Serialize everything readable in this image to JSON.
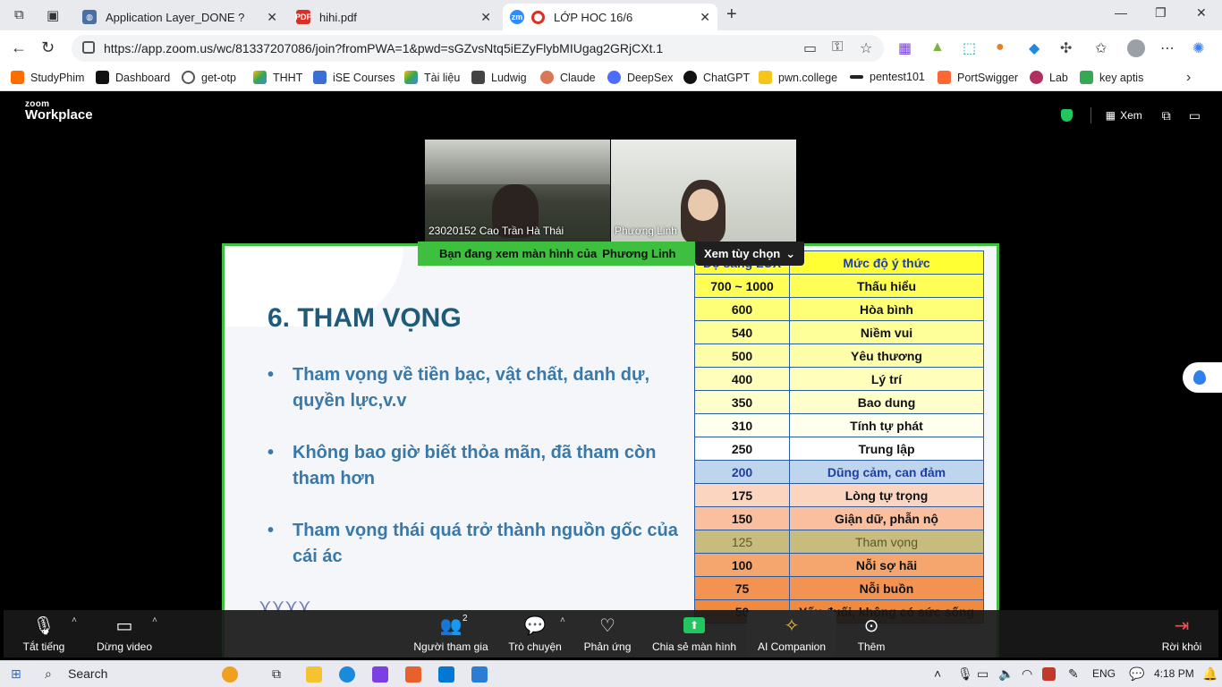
{
  "browser": {
    "tabs": [
      {
        "title": "Application Layer_DONE ?",
        "active": false
      },
      {
        "title": "hihi.pdf",
        "active": false
      },
      {
        "title": "LỚP HOC 16/6",
        "active": true
      }
    ],
    "url": "https://app.zoom.us/wc/81337207086/join?fromPWA=1&pwd=sGZvsNtq5iEZyFlybMIUgag2GRjCXt.1",
    "bookmarks": [
      "StudyPhim",
      "Dashboard",
      "get-otp",
      "THHT",
      "iSE Courses",
      "Tài liệu",
      "Ludwig",
      "Claude",
      "DeepSex",
      "ChatGPT",
      "pwn.college",
      "pentest101",
      "PortSwigger",
      "Lab",
      "key aptis"
    ]
  },
  "zoom": {
    "logo_top": "zoom",
    "logo_bottom": "Workplace",
    "view_label": "Xem",
    "participants": [
      {
        "name": "23020152 Cao Trần Hà Thái"
      },
      {
        "name": "Phương Linh"
      }
    ],
    "banner_text": "Bạn đang xem màn hình của",
    "banner_name": "Phương Linh",
    "view_options": "Xem tùy chọn",
    "slide": {
      "title": "6. THAM VỌNG",
      "bullets": [
        "Tham vọng về tiền bạc, vật chất, danh dự, quyền lực,v.v",
        "Không bao giờ biết thỏa mãn, đã tham còn tham hơn",
        "Tham vọng thái quá trở thành nguồn gốc của cái ác"
      ],
      "table_header": [
        "Độ sáng LUX",
        "Mức độ ý thức"
      ],
      "table_rows": [
        [
          "700 ~ 1000",
          "Thấu hiểu"
        ],
        [
          "600",
          "Hòa bình"
        ],
        [
          "540",
          "Niềm vui"
        ],
        [
          "500",
          "Yêu thương"
        ],
        [
          "400",
          "Lý trí"
        ],
        [
          "350",
          "Bao dung"
        ],
        [
          "310",
          "Tính tự phát"
        ],
        [
          "250",
          "Trung lập"
        ],
        [
          "200",
          "Dũng cảm, can đảm"
        ],
        [
          "175",
          "Lòng tự trọng"
        ],
        [
          "150",
          "Giận dữ, phẫn nộ"
        ],
        [
          "125",
          "Tham vọng"
        ],
        [
          "100",
          "Nỗi sợ hãi"
        ],
        [
          "75",
          "Nỗi buồn"
        ],
        [
          "50",
          "Yếu đuối, không có sức sống"
        ]
      ],
      "row_colors": [
        "#ffff55",
        "#ffff77",
        "#ffff99",
        "#ffffaa",
        "#ffffbb",
        "#ffffcc",
        "#ffffee",
        "#ffffff",
        "#bfd5ee",
        "#fcd5c0",
        "#f9bf9f",
        "#c8bb7e",
        "#f5a56e",
        "#f39352",
        "#f08a3e"
      ]
    },
    "toolbar": {
      "mute": "Tắt tiếng",
      "video": "Dừng video",
      "participants": "Người tham gia",
      "participants_count": "2",
      "chat": "Trò chuyện",
      "reactions": "Phản ứng",
      "share": "Chia sẻ màn hình",
      "ai": "AI Companion",
      "more": "Thêm",
      "leave": "Rời khỏi"
    }
  },
  "taskbar": {
    "search": "Search",
    "lang": "ENG",
    "time": "4:18 PM"
  }
}
